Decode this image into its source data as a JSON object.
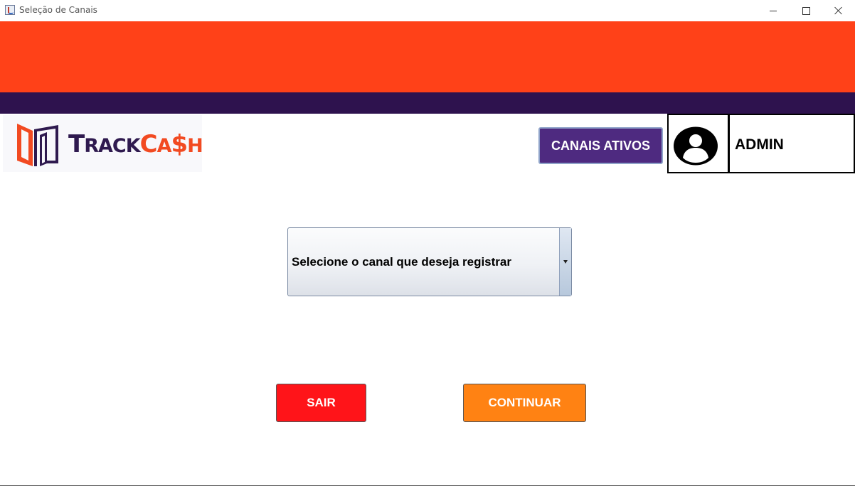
{
  "window": {
    "title": "Seleção de Canais"
  },
  "brand": {
    "part1_first": "T",
    "part1_rest": "RACK",
    "part2_first": "C",
    "part2_mid": "A",
    "part2_dollar": "$",
    "part2_last": "H",
    "colors": {
      "primary_orange": "#ff4118",
      "dark_purple": "#2e124e",
      "button_purple": "#4e2a80",
      "logo_orange": "#f24a21"
    }
  },
  "header": {
    "active_channels_label": "CANAIS ATIVOS",
    "user_name": "ADMIN",
    "avatar_icon": "user-avatar-icon"
  },
  "channel_select": {
    "selected_text": "Selecione o canal que deseja registrar"
  },
  "actions": {
    "exit_label": "SAIR",
    "continue_label": "CONTINUAR",
    "colors": {
      "exit": "#ff1419",
      "continue": "#ff8213"
    }
  }
}
